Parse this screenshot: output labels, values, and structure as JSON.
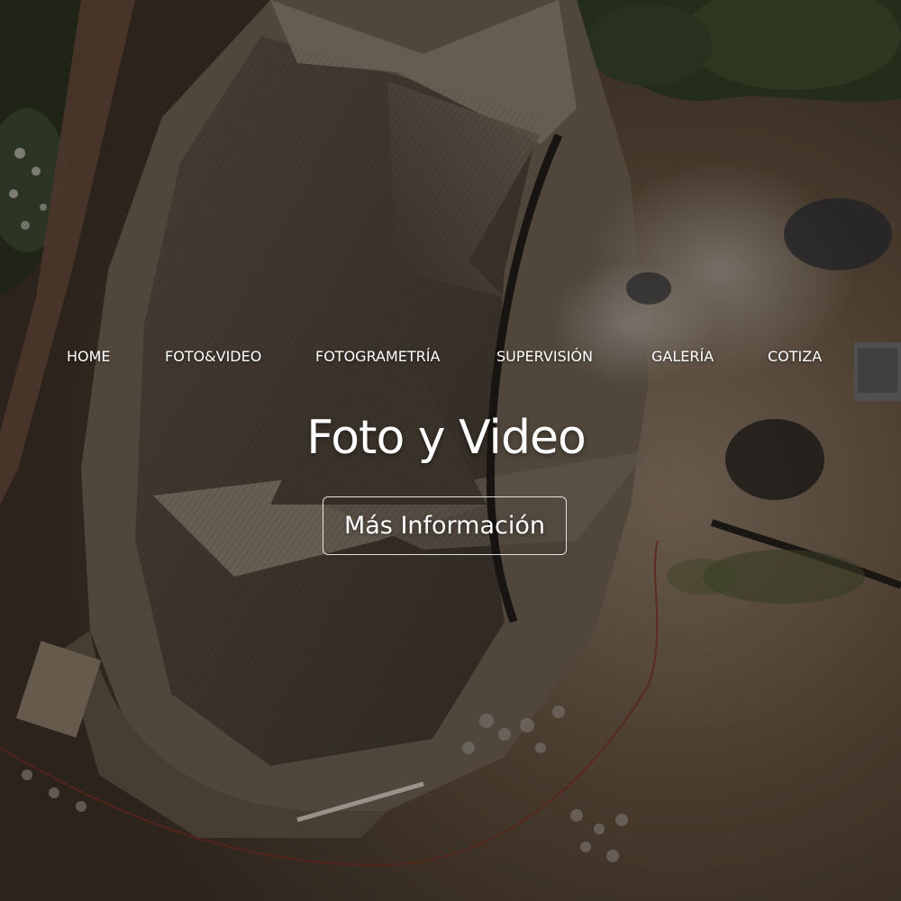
{
  "nav": {
    "items": [
      {
        "label": "HOME"
      },
      {
        "label": "FOTO&VIDEO"
      },
      {
        "label": "FOTOGRAMETRÍA"
      },
      {
        "label": "SUPERVISIÓN"
      },
      {
        "label": "GALERÍA"
      },
      {
        "label": "COTIZA"
      }
    ]
  },
  "hero": {
    "title": "Foto y Video",
    "cta_label": "Más Información"
  },
  "colors": {
    "text": "#ffffff",
    "thatch": "#6b5f4f",
    "ground": "#5a4a38",
    "foliage": "#3b4a2a"
  }
}
